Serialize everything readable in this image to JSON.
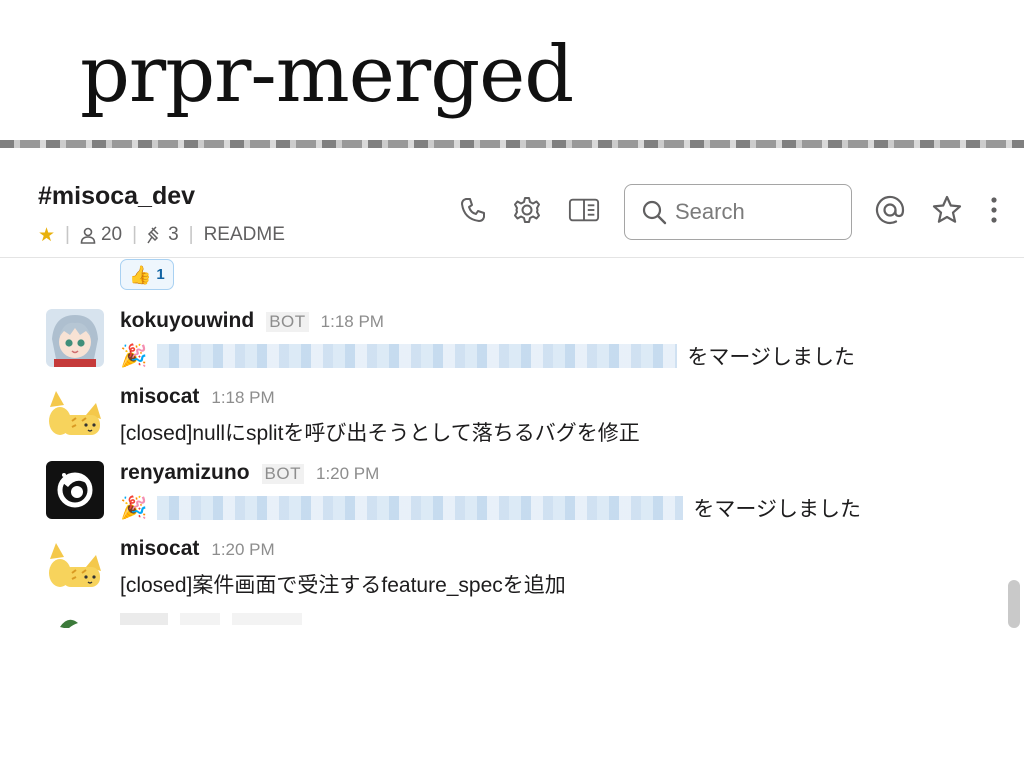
{
  "slide": {
    "title": "prpr-merged"
  },
  "channel": {
    "name": "#misoca_dev",
    "members": "20",
    "pins": "3",
    "readme": "README"
  },
  "search": {
    "placeholder": "Search"
  },
  "reaction": {
    "emoji": "👍",
    "count": "1"
  },
  "messages": [
    {
      "author": "kokuyouwind",
      "bot": "BOT",
      "time": "1:18 PM",
      "prefix_icon": "party-popper-icon",
      "text": "をマージしました",
      "avatar": "anime-character-avatar"
    },
    {
      "author": "misocat",
      "bot": "",
      "time": "1:18 PM",
      "prefix_icon": "",
      "text": "[closed]nullにsplitを呼び出そうとして落ちるバグを修正",
      "avatar": "cat-avatar"
    },
    {
      "author": "renyamizuno",
      "bot": "BOT",
      "time": "1:20 PM",
      "prefix_icon": "party-popper-icon",
      "text": "をマージしました",
      "avatar": "dark-swirl-avatar"
    },
    {
      "author": "misocat",
      "bot": "",
      "time": "1:20 PM",
      "prefix_icon": "",
      "text": "[closed]案件画面で受注するfeature_specを追加",
      "avatar": "cat-avatar"
    }
  ],
  "colors": {
    "star": "#e8b10d",
    "reaction_border": "#a9d1f2",
    "reaction_text": "#1264a3"
  }
}
